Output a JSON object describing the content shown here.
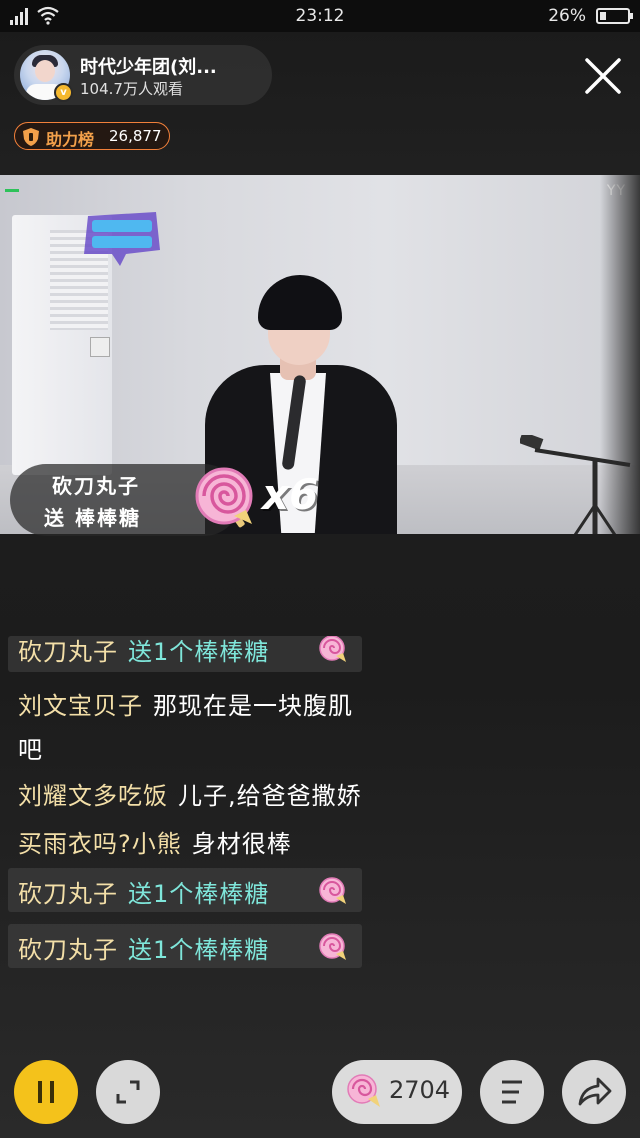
{
  "status_bar": {
    "time": "23:12",
    "battery": "26%",
    "battery_level": 0.26
  },
  "host": {
    "name": "时代少年团(刘...",
    "viewers": "104.7万人观看",
    "verified_mark": "v"
  },
  "rank": {
    "label": "助力榜",
    "value": "26,877"
  },
  "video": {
    "watermark": "YY"
  },
  "gift_banner": {
    "sender": "砍刀丸子",
    "text": "送 棒棒糖",
    "combo": "x6"
  },
  "chat": {
    "messages": [
      {
        "user": "砍刀丸子",
        "text": "送1个棒棒糖",
        "type": "gift"
      },
      {
        "user": "刘文宝贝子",
        "text": "那现在是一块腹肌",
        "type": "text"
      },
      {
        "user": "",
        "text": "吧",
        "type": "continuation"
      },
      {
        "user": "刘耀文多吃饭",
        "text": "儿子,给爸爸撒娇",
        "type": "text"
      },
      {
        "user": "买雨衣吗?小熊",
        "text": "身材很棒",
        "type": "text"
      },
      {
        "user": "砍刀丸子",
        "text": "送1个棒棒糖",
        "type": "gift"
      },
      {
        "user": "砍刀丸子",
        "text": "送1个棒棒糖",
        "type": "gift"
      }
    ]
  },
  "bottom_bar": {
    "gift_count": "2704"
  },
  "colors": {
    "accent_yellow": "#f4c21b",
    "username": "#f3dfa8",
    "gift_text": "#7fe6da",
    "rank_border": "#f2803a"
  }
}
